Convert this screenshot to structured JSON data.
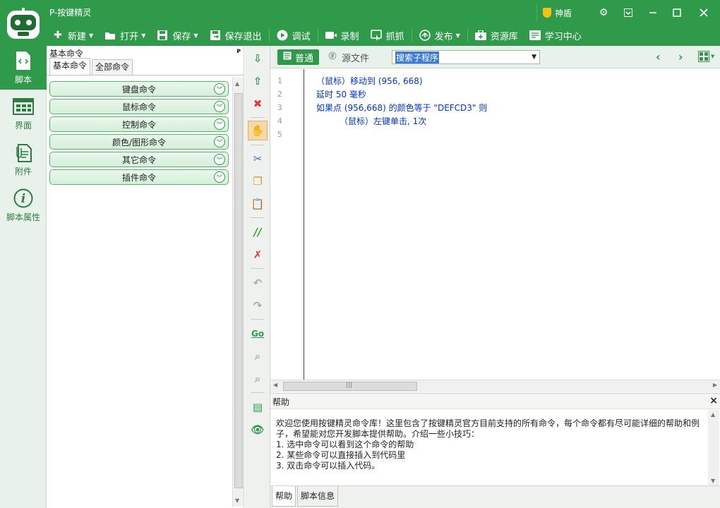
{
  "app": {
    "title": "P-按键精灵",
    "shield_label": "神盾"
  },
  "toolbar": [
    {
      "label": "新建",
      "icon": "plus-icon",
      "dropdown": true
    },
    {
      "label": "打开",
      "icon": "folder-icon",
      "dropdown": true
    },
    {
      "label": "保存",
      "icon": "save-icon",
      "dropdown": true
    },
    {
      "label": "保存退出",
      "icon": "save-exit-icon",
      "dropdown": false
    },
    {
      "label": "调试",
      "icon": "play-icon",
      "dropdown": false
    },
    {
      "label": "录制",
      "icon": "record-icon",
      "dropdown": false
    },
    {
      "label": "抓抓",
      "icon": "grab-icon",
      "dropdown": false
    },
    {
      "label": "发布",
      "icon": "publish-icon",
      "dropdown": true
    },
    {
      "label": "资源库",
      "icon": "library-icon",
      "dropdown": false
    },
    {
      "label": "学习中心",
      "icon": "learn-icon",
      "dropdown": false
    }
  ],
  "leftnav": [
    {
      "label": "脚本",
      "icon": "script-icon",
      "active": true
    },
    {
      "label": "界面",
      "icon": "ui-icon",
      "active": false
    },
    {
      "label": "附件",
      "icon": "attachment-icon",
      "active": false
    },
    {
      "label": "脚本属性",
      "icon": "info-icon",
      "active": false
    }
  ],
  "cmdpanel": {
    "title": "基本命令",
    "pin": "ᴘ",
    "tabs": [
      "基本命令",
      "全部命令"
    ],
    "items": [
      "键盘命令",
      "鼠标命令",
      "控制命令",
      "颜色/图形命令",
      "其它命令",
      "插件命令"
    ]
  },
  "editor": {
    "modes": [
      "普通",
      "源文件"
    ],
    "sub_select": "搜索子程序",
    "lines": [
      {
        "num": "1",
        "text": "（鼠标）移动到 (956, 668)"
      },
      {
        "num": "2",
        "text": "延时 50 毫秒"
      },
      {
        "num": "3",
        "text": "如果点 (956,668) 的颜色等于 \"DEFCD3\" 则"
      },
      {
        "num": "4",
        "text": "（鼠标）左键单击, 1次"
      },
      {
        "num": "5",
        "text": ""
      }
    ],
    "hscroll_grip": "|||"
  },
  "help": {
    "title": "帮助",
    "close": "×",
    "text": [
      "欢迎您使用按键精灵命令库！这里包含了按键精灵官方目前支持的所有命令，每个命令都有尽可能详细的帮助和例",
      "子，希望能对您开发脚本提供帮助。介绍一些小技巧：",
      "1. 选中命令可以看到这个命令的帮助",
      "2. 某些命令可以直接插入到代码里",
      "3. 双击命令可以插入代码。"
    ],
    "tabs": [
      "帮助",
      "脚本信息"
    ]
  },
  "colors": {
    "brand_green": "#2f9a4a",
    "code_blue": "#0033cc"
  }
}
